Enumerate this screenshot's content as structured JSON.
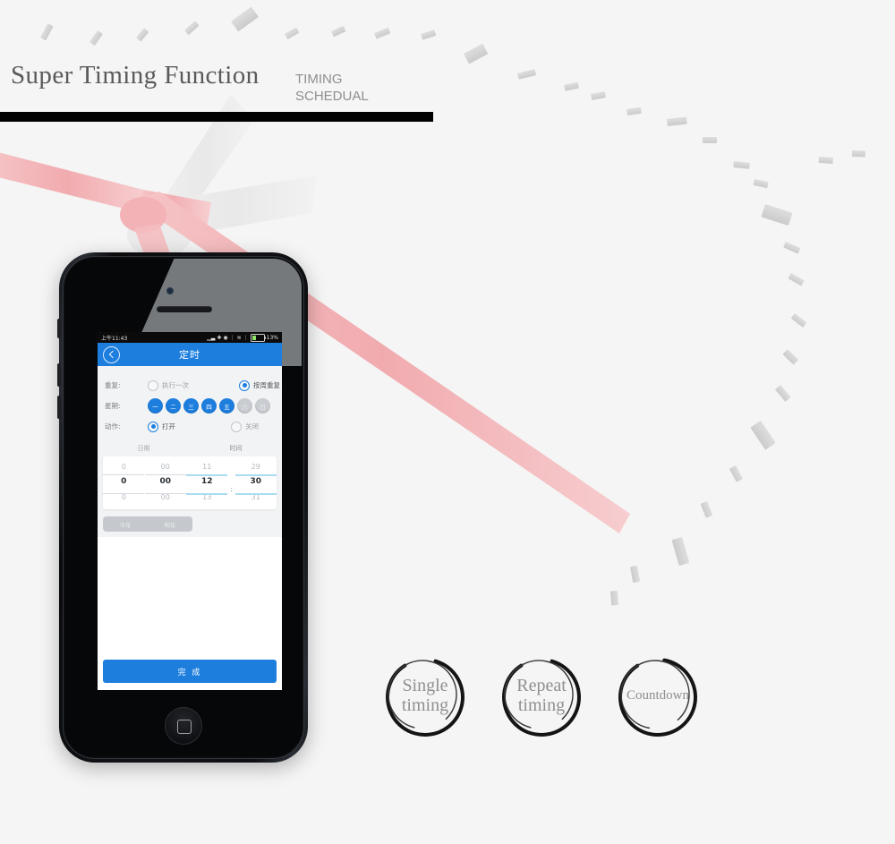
{
  "page": {
    "background_color": "#f5f5f5",
    "accent_color": "#1d7ede",
    "blade_color": "#f4b9bc"
  },
  "headline": {
    "title": "Super Timing Function",
    "subtitle_line1": "TIMING",
    "subtitle_line2": "SCHEDUAL",
    "rule_color": "#000000"
  },
  "phone": {
    "status_bar": {
      "time": "上午11:43",
      "battery_percent": "13%",
      "icons": [
        "signal-icon",
        "bluetooth-icon",
        "shield-icon",
        "vibrate-icon",
        "wifi-icon",
        "sim-icon",
        "battery-icon"
      ]
    },
    "navbar": {
      "back_icon": "chevron-left-icon",
      "title": "定时"
    },
    "form": {
      "repeat": {
        "label": "重复:",
        "option_once": "执行一次",
        "option_weekly": "按周重复",
        "selected": "按周重复"
      },
      "week": {
        "label": "星期:",
        "days": [
          {
            "label": "一",
            "active": true
          },
          {
            "label": "二",
            "active": true
          },
          {
            "label": "三",
            "active": true
          },
          {
            "label": "四",
            "active": true
          },
          {
            "label": "五",
            "active": true
          },
          {
            "label": "六",
            "active": false
          },
          {
            "label": "日",
            "active": false
          }
        ]
      },
      "action": {
        "label": "动作:",
        "option_on": "打开",
        "option_off": "关闭",
        "selected": "打开"
      }
    },
    "picker": {
      "header_date": "日期",
      "header_time": "时间",
      "columns": [
        {
          "name": "date-major",
          "above": "0",
          "selected": "0",
          "below": "0"
        },
        {
          "name": "date-minor",
          "above": "00",
          "selected": "00",
          "below": "00"
        },
        {
          "name": "hour",
          "above": "11",
          "selected": "12",
          "below": "13"
        },
        {
          "name": "minute",
          "above": "29",
          "selected": "30",
          "below": "31"
        }
      ],
      "separator": ":"
    },
    "segmented": {
      "this_year": "今年",
      "next_year": "明年"
    },
    "done_button": "完 成"
  },
  "badges": [
    {
      "line1": "Single",
      "line2": "timing"
    },
    {
      "line1": "Repeat",
      "line2": "timing"
    },
    {
      "line1": "Countdown",
      "line2": ""
    }
  ]
}
